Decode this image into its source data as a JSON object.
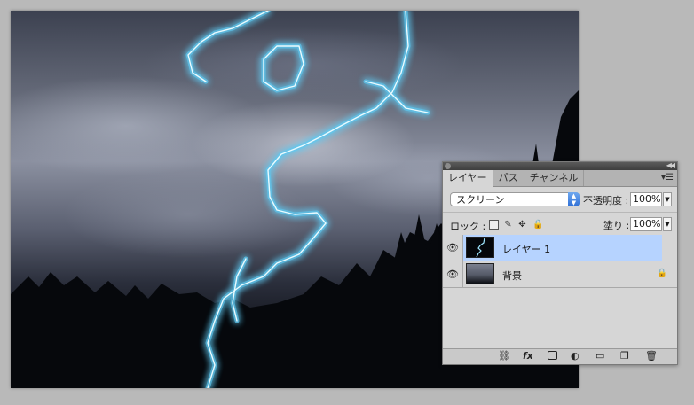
{
  "panel": {
    "tabs": [
      {
        "label": "レイヤー",
        "active": true
      },
      {
        "label": "パス",
        "active": false
      },
      {
        "label": "チャンネル",
        "active": false
      }
    ],
    "blend_mode": "スクリーン",
    "opacity_label": "不透明度 :",
    "opacity_value": "100%",
    "lock_label": "ロック :",
    "fill_label": "塗り :",
    "fill_value": "100%",
    "layers": [
      {
        "name": "レイヤー 1",
        "selected": true,
        "visible": true,
        "locked": false
      },
      {
        "name": "背景",
        "selected": false,
        "visible": true,
        "locked": true
      }
    ],
    "footer_icons": [
      "link-icon",
      "fx-icon",
      "mask-icon",
      "adjustment-icon",
      "folder-icon",
      "new-layer-icon",
      "trash-icon"
    ]
  },
  "colors": {
    "selection": "#b6d3ff",
    "lightning": "#bfefff",
    "lightning_glow": "#5ec8f0",
    "blend_arrow": "#2f6fd6"
  }
}
